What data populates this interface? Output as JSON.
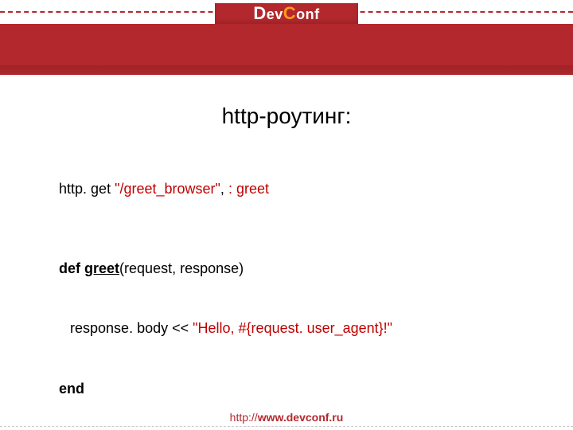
{
  "brand": {
    "part1_cap": "D",
    "part1_rest": "ev",
    "part2_cap": "C",
    "part2_rest": "onf"
  },
  "title": "http-роутинг:",
  "code": {
    "line1": {
      "a": "http. get ",
      "b_red": "\"/greet_browser\"",
      "c": ", ",
      "d_red": ": greet"
    },
    "line3": {
      "a_bold": "def ",
      "b_bold_ul": "greet",
      "c": "(request, response)"
    },
    "line4": {
      "a": "response. body << ",
      "b_red": "\"Hello, #{request. user_agent}!\""
    },
    "line5": {
      "a_bold": "end"
    }
  },
  "footer": {
    "proto": "http://",
    "domain": "www.devconf.ru"
  }
}
